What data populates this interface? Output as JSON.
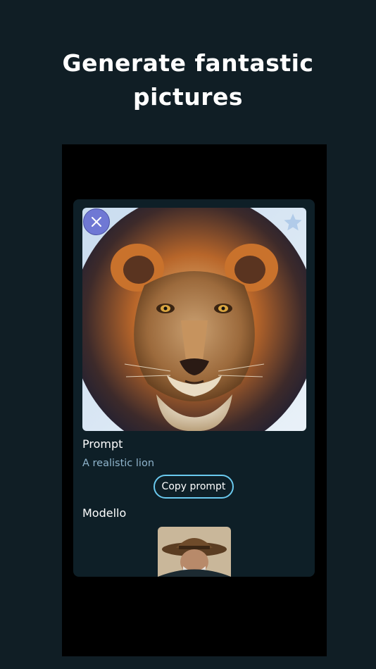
{
  "headline": {
    "line1": "Generate fantastic",
    "line2": "pictures"
  },
  "card": {
    "image_subject": "lion",
    "prompt_label": "Prompt",
    "prompt_text": "A realistic lion",
    "copy_button_label": "Copy prompt",
    "model_label": "Modello",
    "close_icon": "close-icon",
    "favorite_icon": "star-icon"
  },
  "colors": {
    "background": "#101e25",
    "card": "#0e1f27",
    "accent_button": "#6f78d4",
    "outline_button": "#6ac9ee",
    "prompt_text": "#8fb4cc"
  }
}
